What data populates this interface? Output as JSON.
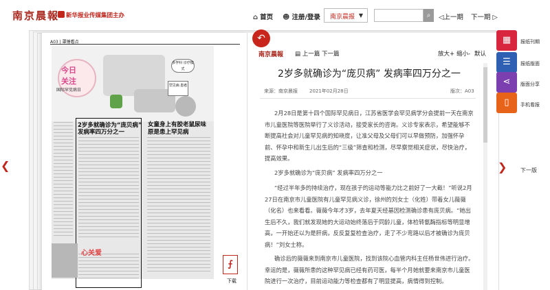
{
  "header": {
    "logo": "南京晨報",
    "sponsor": "新华报业传媒集团主办",
    "home": "首页",
    "register": "注册/登录",
    "paper_select": "南京晨报",
    "search_placeholder": "",
    "prev_issue": "上一期",
    "next_issue": "下一期"
  },
  "newspaper": {
    "page_header": "A03 | 罩锤看点",
    "today_1": "今日",
    "today_2": "关注",
    "today_3": "国际罕见病日",
    "bubble1": "多学科 诊疗模式",
    "bubble2": "罕见病 患者",
    "headline_1a": "2岁多就确诊为“庞贝病”",
    "headline_1b": "发病率四万分之一",
    "headline_2a": "女童身上有胶老鼠尿味",
    "headline_2b": "原是患上罕见病",
    "red_text": "心关爱",
    "download": "下载"
  },
  "reader": {
    "logo": "南京晨報",
    "prev_article": "上一篇",
    "next_article": "下一篇",
    "zoom_in": "放大+",
    "zoom_out": "缩小-",
    "default": "默认",
    "title": "2岁多就确诊为“庞贝病” 发病率四万分之一",
    "source": "来源：南京晨报",
    "date": "2021年02月28日",
    "edition": "版次：A03",
    "paragraphs": [
      "2月28日是第十四个国际罕见病日，江苏省医学会罕见病学分会提前一天在南京市儿童医院等医院举行了义诊活动，接受家长的咨询。义诊专家表示，希望能够不断提高社会对儿童罕见病的知晓度，让准父母及父母们可以早做预防，加强怀孕前、怀孕中和新生儿出生后的“三级”筛查和检测，尽早察觉相关症状，尽快治疗，提高效果。",
      "2岁多就确诊为“庞贝病” 发病率四万分之一",
      "“经过半年多的持续治疗，现在孩子的运动等能力比之前好了一大截！”听说2月27日在南京市儿童医院有儿童罕见病义诊，徐州的刘女士（化姓）带着女儿薇薇（化名）也来看看。薇薇今年才3岁，去年夏天经基因检测确诊患有庞贝病。“她出生后不久，我们就发现她的大运动始终落后于同龄儿童，体检转氨酶指标等明显增高，一开始还以为是肝病，反反复复检查治疗，走了不少弯路以后才被确诊为庞贝病！”刘女士称。",
      "确诊后的薇薇来到南京市儿童医院，找到该院心血管内科主任杨世伟进行治疗。幸运的是，薇薇所患的这种罕见病已经有药可医，每半个月她就要来南京市儿童医院进行一次治疗，目前运动能力等检查都有了明显提高，病情得到控制。"
    ]
  },
  "side": {
    "issue_list": "报纸刊期",
    "layout": "报纸版面",
    "share": "版面分享",
    "mobile": "手机看报",
    "next_edition": "下一版",
    "colors": {
      "issue_list": "#d7263d",
      "layout": "#2f5fb3",
      "share": "#7b3fb0",
      "mobile": "#e8631a"
    }
  }
}
